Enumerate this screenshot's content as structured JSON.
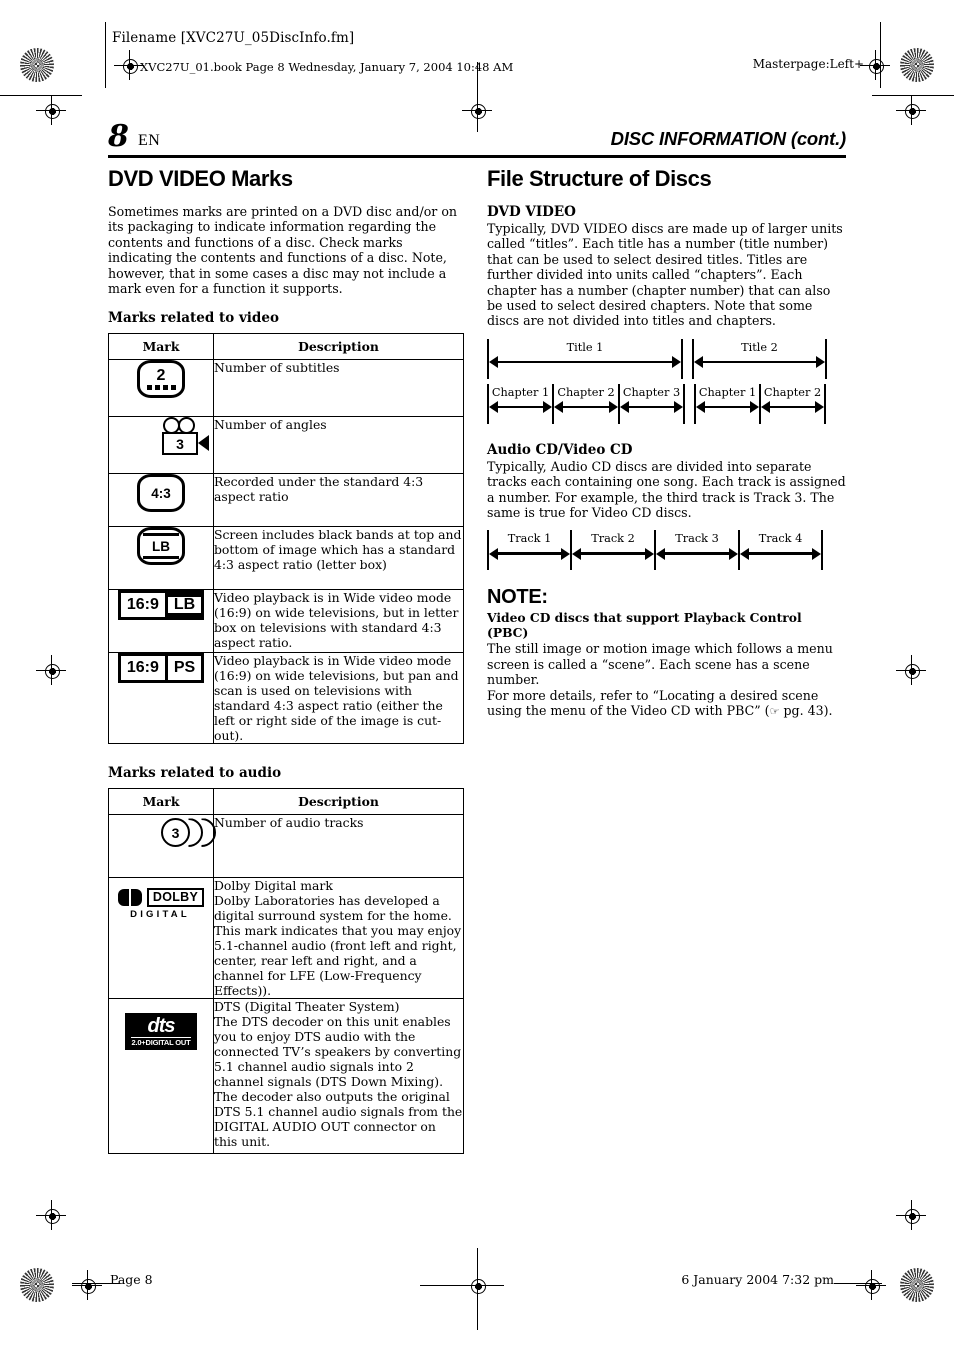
{
  "printheader": {
    "filename": "Filename [XVC27U_05DiscInfo.fm]",
    "bookline": "XVC27U_01.book  Page 8  Wednesday, January 7, 2004  10:48 AM",
    "masterpage": "Masterpage:Left+"
  },
  "pagehead": {
    "page_number": "8",
    "language": "EN",
    "running_head": "DISC INFORMATION (cont.)"
  },
  "left": {
    "title": "DVD VIDEO Marks",
    "intro": "Sometimes marks are printed on a DVD disc and/or on its packaging to indicate information regarding the contents and functions of a disc. Check marks indicating the contents and functions of a disc. Note, however, that in some cases a disc may not include a mark even for a function it supports.",
    "video_heading": "Marks related to video",
    "audio_heading": "Marks related to audio",
    "columns": {
      "mark": "Mark",
      "description": "Description"
    },
    "video_rows": [
      {
        "icon": "tv-subtitles-icon",
        "icon_value": "2",
        "description": "Number of subtitles"
      },
      {
        "icon": "movie-camera-angles-icon",
        "icon_value": "3",
        "description": "Number of angles"
      },
      {
        "icon": "tv-aspect-4-3-icon",
        "icon_value": "4:3",
        "description": "Recorded under the standard 4:3 aspect ratio"
      },
      {
        "icon": "tv-letterbox-icon",
        "icon_value": "LB",
        "description": "Screen includes black bands at top and bottom of image which has a standard 4:3 aspect ratio (letter box)"
      },
      {
        "icon": "badge-16-9-lb-icon",
        "icon_value": "16:9",
        "icon_value2": "LB",
        "description": "Video playback is in Wide video mode (16:9) on wide televisions, but in letter box on televisions with standard 4:3 aspect ratio."
      },
      {
        "icon": "badge-16-9-ps-icon",
        "icon_value": "16:9",
        "icon_value2": "PS",
        "description": "Video playback is in Wide video mode (16:9) on wide televisions, but pan and scan is used on televisions with standard 4:3 aspect ratio (either the left or right side of the image is cut-out)."
      }
    ],
    "audio_rows": [
      {
        "icon": "audio-tracks-icon",
        "icon_value": "3",
        "description": "Number of audio tracks"
      },
      {
        "icon": "dolby-digital-logo",
        "logo_word": "DOLBY",
        "logo_sub": "DIGITAL",
        "description": "Dolby Digital mark\nDolby Laboratories has developed a digital surround system for the home. This mark indicates that you may enjoy 5.1-channel audio (front left and right, center, rear left and right, and a channel for LFE (Low-Frequency Effects))."
      },
      {
        "icon": "dts-logo",
        "logo_word": "dts",
        "logo_sub": "2.0+DIGITAL OUT",
        "description": "DTS (Digital Theater System)\nThe DTS decoder on this unit enables you to enjoy DTS audio with the connected TV’s speakers by converting 5.1 channel audio signals into 2 channel signals (DTS Down Mixing). The decoder also outputs the original DTS 5.1 channel audio signals from the DIGITAL AUDIO OUT connector on this unit."
      }
    ]
  },
  "right": {
    "title": "File Structure of Discs",
    "dvd": {
      "heading": "DVD VIDEO",
      "body": "Typically, DVD VIDEO discs are made up of larger units called “titles”. Each title has a number (title number) that can be used to select desired titles. Titles are further divided into units called “chapters”. Each chapter has a number (chapter number) that can also be used to select desired chapters. Note that some discs are not divided into titles and chapters.",
      "titles": [
        "Title 1",
        "Title 2"
      ],
      "chapters_title1": [
        "Chapter 1",
        "Chapter 2",
        "Chapter 3"
      ],
      "chapters_title2": [
        "Chapter 1",
        "Chapter 2"
      ]
    },
    "cd": {
      "heading": "Audio CD/Video CD",
      "body": "Typically, Audio CD discs are divided into separate tracks each containing one song. Each track is assigned a number. For example, the third track is Track 3. The same is true for Video CD discs.",
      "tracks": [
        "Track 1",
        "Track 2",
        "Track 3",
        "Track 4"
      ]
    },
    "note": {
      "title": "NOTE:",
      "subtitle": "Video CD discs that support Playback Control (PBC)",
      "line1": "The still image or motion image which follows a menu screen is called a “scene”. Each scene has a scene number.",
      "line2_pre": "For more details, refer to “Locating a desired scene using the menu of the Video CD with PBC” (",
      "hand_icon": "☞",
      "line2_post": " pg. 43)."
    }
  },
  "footer": {
    "left": "Page 8",
    "right": "6 January 2004 7:32 pm"
  }
}
